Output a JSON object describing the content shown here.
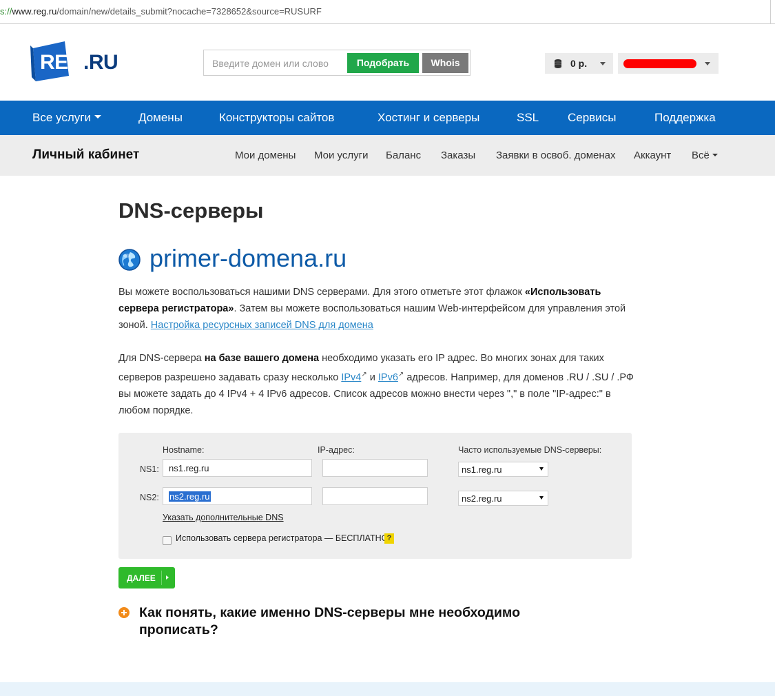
{
  "browser": {
    "url_scheme": "s://",
    "url_host": "www.reg.ru",
    "url_path": "/domain/new/details_submit?nocache=7328652&source=RUSURF"
  },
  "header": {
    "logo_reg": "REG",
    "logo_ru": ".RU",
    "search_placeholder": "Введите домен или слово",
    "pick_button": "Подобрать",
    "whois_button": "Whois",
    "balance": "0 р.",
    "colors": {
      "pick": "#21a74a",
      "whois": "#7a7a7a",
      "brand": "#0a68c0",
      "redaction": "#ff0000"
    }
  },
  "main_nav": {
    "items": [
      {
        "label": "Все услуги"
      },
      {
        "label": "Домены"
      },
      {
        "label": "Конструкторы сайтов"
      },
      {
        "label": "Хостинг и серверы"
      },
      {
        "label": "SSL"
      },
      {
        "label": "Сервисы"
      },
      {
        "label": "Поддержка"
      }
    ]
  },
  "sub_nav": {
    "title": "Личный кабинет",
    "items": [
      {
        "label": "Мои домены"
      },
      {
        "label": "Мои услуги"
      },
      {
        "label": "Баланс"
      },
      {
        "label": "Заказы"
      },
      {
        "label": "Заявки в освоб. доменах"
      },
      {
        "label": "Аккаунт"
      },
      {
        "label": "Всё"
      }
    ]
  },
  "content": {
    "title": "DNS-серверы",
    "domain": "primer-domena.ru",
    "para1": {
      "t1": "Вы можете воспользоваться нашими DNS серверами. Для этого отметьте этот флажок ",
      "b1": "«Использовать сервера регистратора»",
      "t2": ". Затем вы можете воспользоваться нашим Web-интерфейсом для управления этой зоной. ",
      "link": "Настройка ресурсных записей DNS для домена"
    },
    "para2": {
      "t1": "Для DNS-сервера ",
      "b1": "на базе вашего домена",
      "t2": " необходимо указать его IP адрес. Во многих зонах для таких серверов разрешено задавать сразу несколько ",
      "link_ipv4": "IPv4",
      "t3": " и ",
      "link_ipv6": "IPv6",
      "t4": " адресов. Например, для доменов .RU / .SU / .РФ вы можете задать до 4 IPv4 + 4 IPv6 адресов. Список адресов можно внести через \",\" в поле \"IP-адрес:\" в любом порядке."
    }
  },
  "form": {
    "hostname_label": "Hostname:",
    "ip_label": "IP-адрес:",
    "common_label": "Часто используемые DNS-серверы:",
    "rows": [
      {
        "label": "NS1:",
        "hostname": "ns1.reg.ru",
        "ip": "",
        "select": "ns1.reg.ru"
      },
      {
        "label": "NS2:",
        "hostname": "ns2.reg.ru",
        "ip": "",
        "select": "ns2.reg.ru"
      }
    ],
    "more_link": "Указать дополнительные DNS",
    "checkbox_label": "Использовать сервера регистратора — БЕСПЛАТНО",
    "checkbox_checked": false,
    "help": "?",
    "next_button": "ДАЛЕЕ"
  },
  "faq": {
    "question": "Как понять, какие именно DNS-серверы мне необходимо прописать?"
  }
}
